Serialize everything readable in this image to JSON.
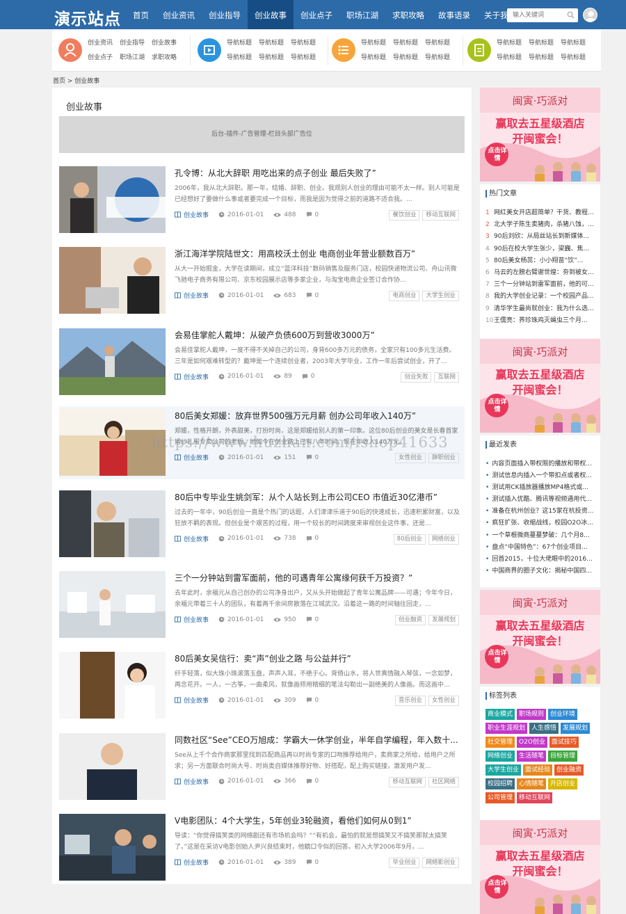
{
  "header": {
    "logo": "演示站点",
    "nav": [
      "首页",
      "创业资讯",
      "创业指导",
      "创业故事",
      "创业点子",
      "职场江湖",
      "求职攻略",
      "故事语录",
      "关于我们"
    ],
    "active_index": 3,
    "search_placeholder": "输入关键词"
  },
  "subnav": {
    "group1": [
      "创业资讯",
      "创业指导",
      "创业故事",
      "创业点子",
      "职场江湖",
      "求职攻略"
    ],
    "group2": [
      "导航标题",
      "导航标题",
      "导航标题",
      "导航标题",
      "导航标题",
      "导航标题"
    ],
    "group3": [
      "导航标题",
      "导航标题",
      "导航标题",
      "导航标题",
      "导航标题",
      "导航标题"
    ],
    "group4": [
      "导航标题",
      "导航标题",
      "导航标题",
      "导航标题",
      "导航标题",
      "导航标题"
    ]
  },
  "breadcrumb": "首页 > 创业故事",
  "main": {
    "title": "创业故事",
    "ad_text": "后台-插件-广告管理-栏目头部广告位"
  },
  "articles": [
    {
      "title": "孔令博：从北大辞职 用吃出来的点子创业 最后失败了”",
      "desc": "2006年，我从北大辞职。那一年，结婚、辞职、创业。我观别人创业的理由可能不太一样。别人可能是已经想好了要做什么事或者要完成一个目标，而我是因为觉得之前的道路不适合我。...",
      "category": "创业故事",
      "date": "2016-01-01",
      "views": "488",
      "comments": "0",
      "tags": [
        "餐饮创业",
        "移动互联网"
      ]
    },
    {
      "title": "浙江海洋学院陆世文：用高校沃土创业 电商创业年营业额数百万”",
      "desc": "从大一开始掘金，大学在读期间，成立“蓝洋科技”数码销售及服务门店，校园快递物流公司、舟山讯微飞驰电子商务有限公司、京东校园展示店等多家企业，与淘宝电商企业签订合作协...",
      "category": "创业故事",
      "date": "2016-01-01",
      "views": "683",
      "comments": "0",
      "tags": [
        "电商创业",
        "大学生创业"
      ]
    },
    {
      "title": "会易佳掌舵人戴坤：从破产负债600万到营收3000万”",
      "desc": "会易佳掌舵人戴坤，一度不得不关掉自己的公司，身背600多万元的债务，全家只有100多元生活费。三年是如何艰难转型的？戴坤是一个连续创业者，2003年大学毕业，工作一年后尝试创业，开了...",
      "category": "创业故事",
      "date": "2016-01-01",
      "views": "89",
      "comments": "0",
      "tags": [
        "创业失败",
        "互联网"
      ]
    },
    {
      "title": "80后美女郑媛：放弃世界500强万元月薪 创办公司年收入140万”",
      "desc": "郑媛，性格开朗，外表甜美，打扮时尚，这是郑媛给别人的第一印象。这位80后创业的美女是长春首家婚纱礼服专卖公司的老板，她如今在创业路上已有八年时间，现在年收入140万元。",
      "category": "创业故事",
      "date": "2016-01-01",
      "views": "151",
      "comments": "0",
      "tags": [
        "女性创业",
        "辞职创业"
      ]
    },
    {
      "title": "80后中专毕业生姚剑军：从个人站长到上市公司CEO 市值近30亿港币”",
      "desc": "过去的一年中，90后创业一直是个热门的话题，人们津津乐道于90后的快速成长，迅速积累财富，以及狂放不羁的表现。但创业是个艰苦的过程，用一个较长的时间跨度来审视创业这件事，还是...",
      "category": "创业故事",
      "date": "2016-01-01",
      "views": "738",
      "comments": "0",
      "tags": [
        "80后创业",
        "网络创业"
      ]
    },
    {
      "title": "三个一分钟站到雷军面前，他的可遇青年公寓缘何获千万投资？”",
      "desc": "去年此时，余福元从自己创办的公司净身出户，又从头开始做起了青年公寓品牌——可遇；今年今日，余福元带着三十人的团队，有着两千余间房散落在江城武汉。沿着这一路的时间轴往回走，...",
      "category": "创业故事",
      "date": "2016-01-01",
      "views": "950",
      "comments": "0",
      "tags": [
        "创业融资",
        "发展规划"
      ]
    },
    {
      "title": "80后美女吴信行：卖“声”创业之路 与公益并行”",
      "desc": "纤手轻落，似大珠小珠滚落玉盘，声声入耳，不绝于心。背倚山水，将人世真情融入琴弦，一念如梦，再念花开。一人，一古筝，一曲柔风，就像画师用精细的笔法勾勒出一副绝美的人像画。而这画中...",
      "category": "创业故事",
      "date": "2016-01-01",
      "views": "309",
      "comments": "0",
      "tags": [
        "音乐创业",
        "女性创业"
      ]
    },
    {
      "title": "同数社区“See”CEO万旭成：学霸大一休学创业，半年自学编程，年入数十...",
      "desc": "See从上千个合作商家那里找到匹配商品再以时尚专家的口吻推荐给用户，卖商家之所给，给用户之所求；另一方面联合时尚大号、时尚类自媒体推荐好物、好搭配，配上购买链接，激发用户发...",
      "category": "创业故事",
      "date": "2016-01-01",
      "views": "366",
      "comments": "0",
      "tags": [
        "移动互联网",
        "社区网络"
      ]
    },
    {
      "title": "V电影团队：4个大学生，5年创业3轮融资，看他们如何从0到1”",
      "desc": "导读：“你觉得搞笑类的网络剧还有市场机会吗？”“有机会，最怕的就是想搞笑又不搞笑那就太搞笑了。”这是在采访V电影创始人尹兴良结束时，他鏡口令似的回答。初入大学2006年9月，...",
      "category": "创业故事",
      "date": "2016-01-01",
      "views": "389",
      "comments": "0",
      "tags": [
        "毕业创业",
        "网络影创业"
      ]
    }
  ],
  "sidebar": {
    "banner": {
      "brand": "闽寅·巧派对",
      "line1": "赢取去五星级酒店",
      "line2": "开闽蜜会！",
      "cta": "点击详情"
    },
    "hot": {
      "title": "热门文章",
      "items": [
        "网红美女开店超简单？干货、教程...",
        "北大学子陈生卖猪肉，杀猪八蚀，...",
        "90后刘欣：从局丝站长到新媒体...",
        "90后在校大学生张少，梁巍、焦...",
        "80后美女杨蕊：小小翔苗“饮”...",
        "马云的左膀右臂谢世煌：夯到被女...",
        "三个一分钟站到雷军面前，他的可...",
        "我的大学创业记录：一个校园产品...",
        "清华学生最尚就创业：我为什么选...",
        "王儒亮：荞珍珠鸡灭蝇虫三个月..."
      ]
    },
    "latest": {
      "title": "最近发表",
      "items": [
        "内容页面插入带权限的播放和带权...",
        "测试信息内插入一个带扣点或者权...",
        "测试用CK插放器播放MP4格式或...",
        "测试插入优酷、腾讯等视频通用代...",
        "准备在杭州创业？这15家在杭投资...",
        "疯狂扩张、收缩战线，校园O2O冰...",
        "一个草根微商蔓蔓梦破：几个月8...",
        "盘点“中国特色”：67个创业项目...",
        "回首2015，十位大佬眼中的2016...",
        "中国商界的圈子文化：揭秘中国四..."
      ]
    },
    "tags": {
      "title": "标签列表",
      "items": [
        {
          "t": "商业模式",
          "c": "#1aa7a0"
        },
        {
          "t": "职场规则",
          "c": "#c238c9"
        },
        {
          "t": "创业环境",
          "c": "#2c8ad4"
        },
        {
          "t": "职业生涯规划",
          "c": "#c238c9"
        },
        {
          "t": "人生感悟",
          "c": "#3a6f84"
        },
        {
          "t": "发展规划",
          "c": "#2c8ad4"
        },
        {
          "t": "社交管理",
          "c": "#f0891b"
        },
        {
          "t": "O2O创业",
          "c": "#c238c9"
        },
        {
          "t": "面试技巧",
          "c": "#e65a26"
        },
        {
          "t": "网络创业",
          "c": "#1aa7a0"
        },
        {
          "t": "生活随笔",
          "c": "#c238c9"
        },
        {
          "t": "目标管理",
          "c": "#3aa63a"
        },
        {
          "t": "大学生创业",
          "c": "#1aa7a0"
        },
        {
          "t": "面试经验",
          "c": "#e6871b"
        },
        {
          "t": "创业融资",
          "c": "#e65a26"
        },
        {
          "t": "校园招聘",
          "c": "#3a6f84"
        },
        {
          "t": "心情随笔",
          "c": "#e6871b"
        },
        {
          "t": "开店创业",
          "c": "#d8b800"
        },
        {
          "t": "公司管理",
          "c": "#e65a26"
        },
        {
          "t": "移动互联网",
          "c": "#e0455a"
        }
      ]
    }
  },
  "watermark": "https://www.huzhan.com/ishop41633",
  "colors": {
    "header": "#2c6aa8",
    "nav_active": "#174d85",
    "accent": "#2c6aa8",
    "banner_pink": "#e8375a"
  }
}
